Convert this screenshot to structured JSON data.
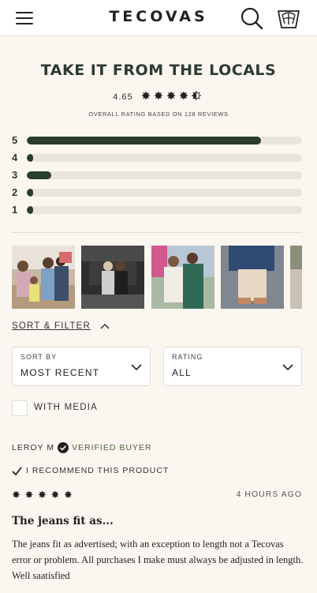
{
  "header": {
    "brand": "TECOVAS",
    "menu_icon": "hamburger-menu-icon",
    "search_icon": "search-icon",
    "cart_icon": "cart-icon"
  },
  "reviews_summary": {
    "title": "TAKE IT FROM THE LOCALS",
    "average_rating": "4.65",
    "average_stars_value": 4.65,
    "overall_text": "OVERALL RATING BASED ON 128 REVIEWS",
    "histogram": [
      {
        "label": "5",
        "fraction": 0.85
      },
      {
        "label": "4",
        "fraction": 0.02
      },
      {
        "label": "3",
        "fraction": 0.09
      },
      {
        "label": "2",
        "fraction": 0.02
      },
      {
        "label": "1",
        "fraction": 0.02
      }
    ]
  },
  "photos": [
    {
      "name": "customer-photo-family"
    },
    {
      "name": "customer-photo-friends"
    },
    {
      "name": "customer-photo-couple"
    },
    {
      "name": "customer-photo-boots"
    },
    {
      "name": "customer-photo-partial"
    }
  ],
  "filters": {
    "sort_filter_label": "SORT & FILTER",
    "sort": {
      "label": "SORT BY",
      "value": "MOST RECENT"
    },
    "rating": {
      "label": "RATING",
      "value": "ALL"
    },
    "with_media_label": "WITH MEDIA",
    "with_media_checked": false
  },
  "review": {
    "author": "LEROY M",
    "verified": "VERIFIED BUYER",
    "recommend": "I RECOMMEND THIS PRODUCT",
    "stars": "✸ ✸ ✸ ✸ ✸",
    "rating": 5,
    "time": "4 HOURS AGO",
    "title": "The jeans fit as...",
    "body": "The jeans fit as advertised; with an exception to length not a Tecovas error or problem. All purchases I make must always be adjusted in length. Well saatisfied"
  },
  "colors": {
    "background": "#fbf6f0",
    "accent": "#2a3d2f",
    "verified": "#4a5e3c"
  }
}
